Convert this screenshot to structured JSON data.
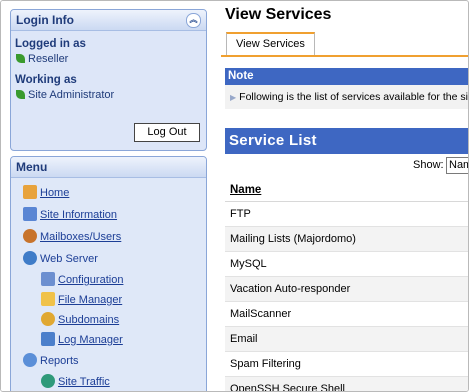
{
  "login": {
    "title": "Login Info",
    "logged_in_label": "Logged in as",
    "logged_in_value": "Reseller",
    "working_label": "Working as",
    "working_value": "Site Administrator",
    "logout_button": "Log Out"
  },
  "menu": {
    "title": "Menu",
    "items": [
      {
        "label": "Home",
        "icon": "home-icon"
      },
      {
        "label": "Site Information",
        "icon": "site-info-icon"
      },
      {
        "label": "Mailboxes/Users",
        "icon": "users-icon"
      },
      {
        "label": "Web Server",
        "icon": "globe-icon"
      },
      {
        "label": "Configuration",
        "icon": "config-icon"
      },
      {
        "label": "File Manager",
        "icon": "folder-icon"
      },
      {
        "label": "Subdomains",
        "icon": "subdomains-icon"
      },
      {
        "label": "Log Manager",
        "icon": "log-icon"
      },
      {
        "label": "Reports",
        "icon": "reports-icon"
      },
      {
        "label": "Site Traffic",
        "icon": "traffic-icon"
      }
    ]
  },
  "main": {
    "title": "View Services",
    "tab": "View Services",
    "note_title": "Note",
    "note_text": "Following is the list of services available for the site.",
    "service_list_title": "Service List",
    "show_label": "Show:",
    "show_value": "Name",
    "column_header": "Name",
    "services": [
      "FTP",
      "Mailing Lists (Majordomo)",
      "MySQL",
      "Vacation Auto-responder",
      "MailScanner",
      "Email",
      "Spam Filtering",
      "OpenSSH Secure Shell"
    ]
  },
  "colors": {
    "accent_blue": "#3e67c2",
    "tab_orange": "#f0a030",
    "panel_bg": "#d9e4f7"
  }
}
